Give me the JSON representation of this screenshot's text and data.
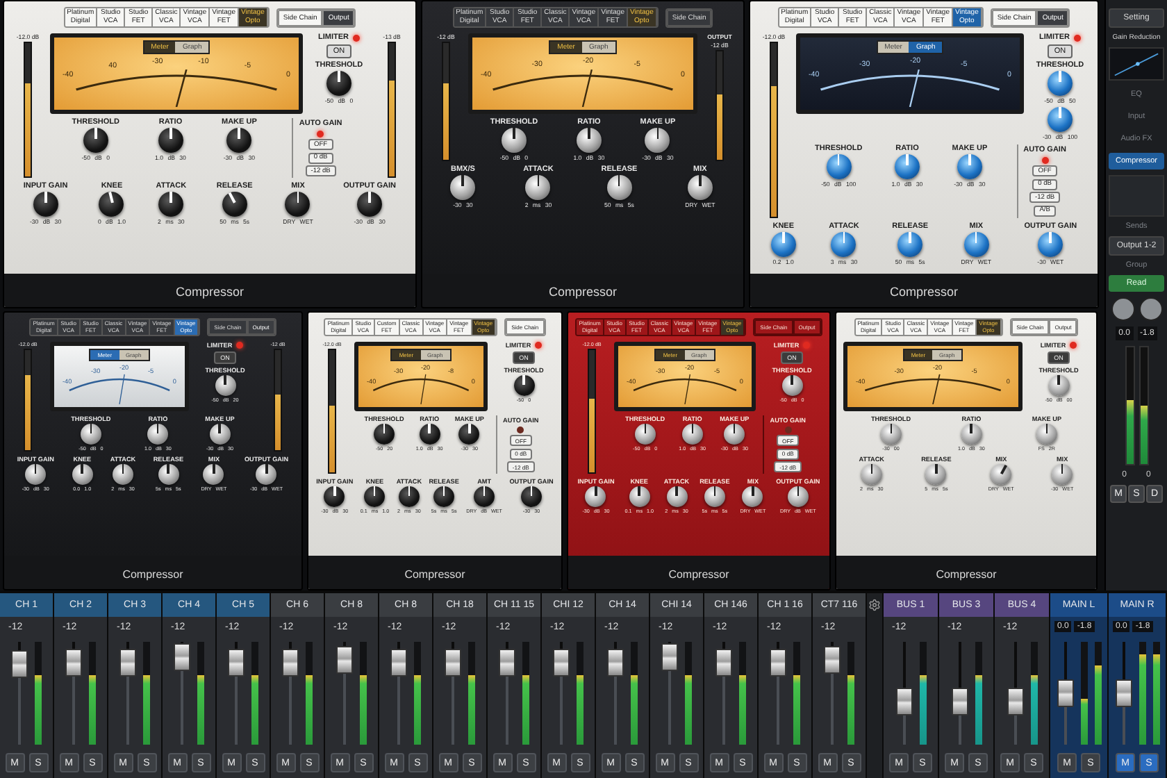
{
  "panels": [
    {
      "kind": "silver",
      "models": [
        {
          "label": "Platinum Digital",
          "selected": false
        },
        {
          "label": "Studio VCA",
          "selected": false
        },
        {
          "label": "Studio FET",
          "selected": false
        },
        {
          "label": "Classic VCA",
          "selected": false
        },
        {
          "label": "Vintage VCA",
          "selected": false
        },
        {
          "label": "Vintage FET",
          "selected": false
        },
        {
          "label": "Vintage Opto",
          "selected": true
        }
      ],
      "routing": [
        {
          "label": "Side Chain",
          "selected": false
        },
        {
          "label": "Output",
          "selected": true
        }
      ],
      "input_meter": {
        "reading": "-12.0 dB",
        "level": 0.7
      },
      "output_meter": {
        "reading": "-13 dB",
        "level": 0.72
      },
      "display": {
        "modes": [
          {
            "label": "Meter",
            "selected": true
          },
          {
            "label": "Graph",
            "selected": false
          }
        ],
        "scale": [
          "-40",
          "40",
          "-30",
          "-10",
          "-5",
          "0"
        ]
      },
      "limiter": {
        "label": "LIMITER",
        "led": true,
        "button": {
          "label": "ON",
          "on": true
        },
        "threshold": {
          "label": "THRESHOLD",
          "scale": "-50 dB 0",
          "level": 0.5
        }
      },
      "knob_rows": [
        [
          {
            "label": "THRESHOLD",
            "scale": "-50 dB 0",
            "level": 0.5
          },
          {
            "label": "RATIO",
            "scale": "1.0 dB 30",
            "level": 0.5
          },
          {
            "label": "MAKE UP",
            "scale": "-30 dB 30",
            "level": 0.5
          }
        ],
        [
          {
            "label": "INPUT GAIN",
            "scale": "-30 dB 30",
            "level": 0.5
          },
          {
            "label": "KNEE",
            "scale": "0 dB 1.0",
            "level": 0.45
          },
          {
            "label": "ATTACK",
            "scale": "2 ms 30",
            "level": 0.5
          },
          {
            "label": "RELEASE",
            "scale": "50 ms 5s",
            "level": 0.4
          },
          {
            "label": "MIX",
            "scale": "DRY WET",
            "level": 0.5
          },
          {
            "label": "OUTPUT GAIN",
            "scale": "-30 dB 30",
            "level": 0.5
          }
        ]
      ],
      "auto_gain": {
        "label": "AUTO GAIN",
        "led": true,
        "buttons": [
          "OFF",
          "0 dB",
          "-12 dB"
        ]
      },
      "footer": "Compressor"
    },
    {
      "kind": "black",
      "models": [
        {
          "label": "Platinum Digital",
          "selected": false
        },
        {
          "label": "Studio VCA",
          "selected": false
        },
        {
          "label": "Studio FET",
          "selected": false
        },
        {
          "label": "Classic VCA",
          "selected": false
        },
        {
          "label": "Vintage VCA",
          "selected": false
        },
        {
          "label": "Vintage FET",
          "selected": false
        },
        {
          "label": "Vintage Opto",
          "selected": true
        }
      ],
      "routing": [
        {
          "label": "Side Chain",
          "selected": false
        }
      ],
      "input_meter": {
        "reading": "-12 dB",
        "level": 0.65
      },
      "output_meter": {
        "title": "OUTPUT",
        "reading": "-12 dB",
        "level": 0.6
      },
      "display": {
        "modes": [
          {
            "label": "Meter",
            "selected": true
          },
          {
            "label": "Graph",
            "selected": false
          }
        ],
        "scale": [
          "-40",
          "-30",
          "-20",
          "-5",
          "0"
        ]
      },
      "knob_rows": [
        [
          {
            "label": "THRESHOLD",
            "scale": "-50 dB 0",
            "level": 0.5
          },
          {
            "label": "RATIO",
            "scale": "1.0 dB 30",
            "level": 0.5
          },
          {
            "label": "MAKE UP",
            "scale": "-30 dB 30",
            "level": 0.5
          }
        ],
        [
          {
            "label": "BMX/S",
            "scale": "-30 30",
            "level": 0.5
          },
          {
            "label": "ATTACK",
            "scale": "2 ms 30",
            "level": 0.5
          },
          {
            "label": "RELEASE",
            "scale": "50 ms 5s",
            "level": 0.5
          },
          {
            "label": "MIX",
            "scale": "DRY WET",
            "level": 0.5
          }
        ]
      ],
      "footer": "Compressor"
    },
    {
      "kind": "silver",
      "models": [
        {
          "label": "Platinum Digital",
          "selected": false
        },
        {
          "label": "Studio VCA",
          "selected": false
        },
        {
          "label": "Studio FET",
          "selected": false
        },
        {
          "label": "Classic VCA",
          "selected": false
        },
        {
          "label": "Vintage VCA",
          "selected": false
        },
        {
          "label": "Vintage FET",
          "selected": false
        },
        {
          "label": "Vintage Opto",
          "selected": true
        }
      ],
      "routing": [
        {
          "label": "Side Chain",
          "selected": false
        },
        {
          "label": "Output",
          "selected": true
        }
      ],
      "input_meter": {
        "reading": "-12.0 dB",
        "level": 0.75
      },
      "display": {
        "modes": [
          {
            "label": "Meter",
            "selected": false
          },
          {
            "label": "Graph",
            "selected": true
          }
        ],
        "scale": [
          "-40",
          "-30",
          "-20",
          "-5",
          "0"
        ]
      },
      "limiter": {
        "label": "LIMITER",
        "led": true,
        "button": {
          "label": "ON",
          "on": true
        },
        "threshold": {
          "label": "THRESHOLD",
          "scale": "-50 dB 50",
          "level": 0.5
        },
        "extra": {
          "scale": "-30 dB 100",
          "level": 0.5
        }
      },
      "knob_rows": [
        [
          {
            "label": "THRESHOLD",
            "scale": "-50 dB 100",
            "level": 0.5
          },
          {
            "label": "RATIO",
            "scale": "1.0 dB 30",
            "level": 0.5
          },
          {
            "label": "MAKE UP",
            "scale": "-30 dB 30",
            "level": 0.5
          }
        ],
        [
          {
            "label": "KNEE",
            "scale": "0.2 1.0",
            "level": 0.5
          },
          {
            "label": "ATTACK",
            "scale": "3 ms 30",
            "level": 0.5
          },
          {
            "label": "RELEASE",
            "scale": "50 ms 5s",
            "level": 0.5
          },
          {
            "label": "MIX",
            "scale": "DRY WET",
            "level": 0.5
          },
          {
            "label": "OUTPUT GAIN",
            "scale": "-30 WET",
            "level": 0.5
          }
        ]
      ],
      "auto_gain": {
        "label": "AUTO GAIN",
        "led": true,
        "buttons": [
          "OFF",
          "0 dB",
          "-12 dB",
          "A/B"
        ]
      },
      "footer": "Compressor"
    },
    {
      "kind": "black",
      "models": [
        {
          "label": "Platinum Digital",
          "selected": false
        },
        {
          "label": "Studio VCA",
          "selected": false
        },
        {
          "label": "Studio FET",
          "selected": false
        },
        {
          "label": "Classic VCA",
          "selected": false
        },
        {
          "label": "Vintage VCA",
          "selected": false
        },
        {
          "label": "Vintage FET",
          "selected": false
        },
        {
          "label": "Vintage Opto",
          "selected": true
        }
      ],
      "routing": [
        {
          "label": "Side Chain",
          "selected": false
        },
        {
          "label": "Output",
          "selected": true
        }
      ],
      "input_meter": {
        "reading": "-12.0 dB",
        "level": 0.75
      },
      "output_meter": {
        "reading": "-12 dB",
        "level": 0.55
      },
      "display": {
        "modes": [
          {
            "label": "Meter",
            "selected": true
          },
          {
            "label": "Graph",
            "selected": false
          }
        ],
        "scale": [
          "-40",
          "-30",
          "-20",
          "-5",
          "0"
        ]
      },
      "limiter": {
        "label": "LIMITER",
        "led": true,
        "button": {
          "label": "ON",
          "on": false
        },
        "threshold": {
          "label": "THRESHOLD",
          "scale": "-50 dB 20",
          "level": 0.5
        }
      },
      "knob_rows": [
        [
          {
            "label": "THRESHOLD",
            "scale": "-50 dB 0",
            "level": 0.5
          },
          {
            "label": "RATIO",
            "scale": "1.0 dB 30",
            "level": 0.5
          },
          {
            "label": "MAKE UP",
            "scale": "-30 dB 30",
            "level": 0.5
          }
        ],
        [
          {
            "label": "INPUT GAIN",
            "scale": "-30 dB 30",
            "level": 0.5
          },
          {
            "label": "KNEE",
            "scale": "0.0 1.0",
            "level": 0.5
          },
          {
            "label": "ATTACK",
            "scale": "2 ms 30",
            "level": 0.5
          },
          {
            "label": "RELEASE",
            "scale": "5s ms 5s",
            "level": 0.5
          },
          {
            "label": "MIX",
            "scale": "DRY WET",
            "level": 0.5
          },
          {
            "label": "OUTPUT GAIN",
            "scale": "-30 dB WET",
            "level": 0.5
          }
        ]
      ],
      "footer": "Compressor"
    },
    {
      "kind": "silver",
      "models": [
        {
          "label": "Platinum Digital",
          "selected": false
        },
        {
          "label": "Studio VCA",
          "selected": false
        },
        {
          "label": "Custom FET",
          "selected": false
        },
        {
          "label": "Classic VCA",
          "selected": false
        },
        {
          "label": "Vintage VCA",
          "selected": false
        },
        {
          "label": "Vintage FET",
          "selected": false
        },
        {
          "label": "Vintage Opto",
          "selected": true
        }
      ],
      "routing": [
        {
          "label": "Side Chain",
          "selected": false
        }
      ],
      "input_meter": {
        "reading": "-12.0 dB",
        "level": 0.55
      },
      "display": {
        "modes": [
          {
            "label": "Meter",
            "selected": true
          },
          {
            "label": "Graph",
            "selected": false
          }
        ],
        "scale": [
          "-40",
          "-30",
          "-20",
          "-8",
          "0"
        ]
      },
      "limiter": {
        "label": "LIMITER",
        "led": true,
        "button": {
          "label": "ON",
          "on": false
        },
        "threshold": {
          "label": "THRESHOLD",
          "scale": "-50 0",
          "level": 0.5
        }
      },
      "knob_rows": [
        [
          {
            "label": "THRESHOLD",
            "scale": "-50 20",
            "level": 0.5
          },
          {
            "label": "RATIO",
            "scale": "1.0 dB 30",
            "level": 0.5
          },
          {
            "label": "MAKE UP",
            "scale": "-30 30",
            "level": 0.5
          }
        ],
        [
          {
            "label": "INPUT GAIN",
            "scale": "-30 dB 30",
            "level": 0.5
          },
          {
            "label": "KNEE",
            "scale": "0.1 ms 1.0",
            "level": 0.5
          },
          {
            "label": "ATTACK",
            "scale": "2 ms 30",
            "level": 0.5
          },
          {
            "label": "RELEASE",
            "scale": "5s ms 5s",
            "level": 0.5
          },
          {
            "label": "AMT",
            "scale": "DRY dB WET",
            "level": 0.5
          },
          {
            "label": "OUTPUT GAIN",
            "scale": "-30 30",
            "level": 0.5
          }
        ]
      ],
      "auto_gain": {
        "label": "AUTO GAIN",
        "led": false,
        "buttons": [
          "OFF",
          "0 dB",
          "-12 dB"
        ]
      },
      "footer": "Compressor"
    },
    {
      "kind": "red",
      "models": [
        {
          "label": "Platinum Digital",
          "selected": false
        },
        {
          "label": "Studio VCA",
          "selected": false
        },
        {
          "label": "Studio FET",
          "selected": false
        },
        {
          "label": "Classic VCA",
          "selected": false
        },
        {
          "label": "Vintage VCA",
          "selected": false
        },
        {
          "label": "Vintage FET",
          "selected": false
        },
        {
          "label": "Vintage Opto",
          "selected": true
        }
      ],
      "routing": [
        {
          "label": "Side Chain",
          "selected": false
        },
        {
          "label": "Output",
          "selected": false
        }
      ],
      "input_meter": {
        "reading": "-12.0 dB",
        "level": 0.6
      },
      "display": {
        "modes": [
          {
            "label": "Meter",
            "selected": true
          },
          {
            "label": "Graph",
            "selected": false
          }
        ],
        "scale": [
          "-40",
          "-30",
          "-20",
          "-5",
          "0"
        ]
      },
      "limiter": {
        "label": "LIMITER",
        "led": true,
        "button": {
          "label": "ON",
          "on": false
        },
        "threshold": {
          "label": "THRESHOLD",
          "scale": "-50 dB 0",
          "level": 0.5
        }
      },
      "knob_rows": [
        [
          {
            "label": "THRESHOLD",
            "scale": "-50 dB 0",
            "level": 0.5
          },
          {
            "label": "RATIO",
            "scale": "1.0 dB 30",
            "level": 0.5
          },
          {
            "label": "MAKE UP",
            "scale": "-30 dB 30",
            "level": 0.5
          }
        ],
        [
          {
            "label": "INPUT GAIN",
            "scale": "-30 dB 30",
            "level": 0.5
          },
          {
            "label": "KNEE",
            "scale": "0.1 ms 1.0",
            "level": 0.5
          },
          {
            "label": "ATTACK",
            "scale": "2 ms 30",
            "level": 0.5
          },
          {
            "label": "RELEASE",
            "scale": "5s ms 5s",
            "level": 0.5
          },
          {
            "label": "MIX",
            "scale": "DRY WET",
            "level": 0.5
          },
          {
            "label": "OUTPUT GAIN",
            "scale": "DRY dB WET",
            "level": 0.5
          }
        ]
      ],
      "auto_gain": {
        "label": "AUTO GAIN",
        "led": false,
        "buttons": [
          "OFF",
          "0 dB",
          "-12 dB"
        ]
      },
      "footer": "Compressor"
    },
    {
      "kind": "silver",
      "models": [
        {
          "label": "Platinum Digital",
          "selected": false
        },
        {
          "label": "Studio VCA",
          "selected": false
        },
        {
          "label": "Classic VCA",
          "selected": false
        },
        {
          "label": "Vintage VCA",
          "selected": false
        },
        {
          "label": "Vintage FET",
          "selected": false
        },
        {
          "label": "Vintage Opto",
          "selected": true
        }
      ],
      "routing": [
        {
          "label": "Side Chain",
          "selected": false
        },
        {
          "label": "Output",
          "selected": false
        }
      ],
      "display": {
        "modes": [
          {
            "label": "Meter",
            "selected": true
          },
          {
            "label": "Graph",
            "selected": false
          }
        ],
        "scale": [
          "-40",
          "-30",
          "-20",
          "-5",
          "0"
        ]
      },
      "limiter": {
        "label": "LIMITER",
        "led": true,
        "button": {
          "label": "ON",
          "on": false
        },
        "threshold": {
          "label": "THRESHOLD",
          "scale": "-50 dB 00",
          "level": 0.5
        }
      },
      "knob_rows": [
        [
          {
            "label": "THRESHOLD",
            "scale": "-30 00",
            "level": 0.5
          },
          {
            "label": "RATIO",
            "scale": "1.0 dB 30",
            "level": 0.5
          },
          {
            "label": "MAKE UP",
            "scale": "FS 2R",
            "level": 0.5
          }
        ],
        [
          {
            "label": "ATTACK",
            "scale": "2 ms 30",
            "level": 0.5
          },
          {
            "label": "RELEASE",
            "scale": "5 ms 5s",
            "level": 0.5
          },
          {
            "label": "MIX",
            "scale": "DRY WET",
            "level": 0.6
          },
          {
            "label": "MIX",
            "scale": "-30 WET",
            "level": 0.5
          }
        ]
      ],
      "footer": "Compressor"
    }
  ],
  "sidebar": {
    "setting": "Setting",
    "gain_reduction": "Gain Reduction",
    "sections": [
      {
        "label": "EQ",
        "selected": false
      },
      {
        "label": "Input",
        "selected": false
      },
      {
        "label": "Audio FX",
        "selected": false
      },
      {
        "label": "Compressor",
        "selected": true
      }
    ],
    "sends": "Sends",
    "output": "Output 1-2",
    "group": "Group",
    "automation": "Read",
    "pan_readings": [
      "0.0",
      "-1.8"
    ],
    "meters": [
      {
        "level": 0.55
      },
      {
        "level": 0.5
      }
    ],
    "meter_labels": [
      "0",
      "0"
    ],
    "buttons": [
      {
        "label": "M",
        "on": false
      },
      {
        "label": "S",
        "on": false
      },
      {
        "label": "D",
        "on": false
      }
    ]
  },
  "mixer": {
    "strips": [
      {
        "kind": "channel",
        "name": "CH 1",
        "selected": true,
        "readings": [
          "-12"
        ],
        "level": 0.78,
        "meters": [
          {
            "level": 0.68
          }
        ],
        "buttons": [
          {
            "label": "M",
            "on": false
          },
          {
            "label": "S",
            "on": false
          }
        ]
      },
      {
        "kind": "channel",
        "name": "CH 2",
        "selected": true,
        "readings": [
          "-12"
        ],
        "level": 0.8,
        "meters": [
          {
            "level": 0.68
          }
        ],
        "buttons": [
          {
            "label": "M",
            "on": false
          },
          {
            "label": "S",
            "on": false
          }
        ]
      },
      {
        "kind": "channel",
        "name": "CH 3",
        "selected": true,
        "readings": [
          "-12"
        ],
        "level": 0.8,
        "meters": [
          {
            "level": 0.68
          }
        ],
        "buttons": [
          {
            "label": "M",
            "on": false
          },
          {
            "label": "S",
            "on": false
          }
        ]
      },
      {
        "kind": "channel",
        "name": "CH 4",
        "selected": true,
        "readings": [
          "-12"
        ],
        "level": 0.85,
        "meters": [
          {
            "level": 0.68
          }
        ],
        "buttons": [
          {
            "label": "M",
            "on": false
          },
          {
            "label": "S",
            "on": false
          }
        ]
      },
      {
        "kind": "channel",
        "name": "CH 5",
        "selected": true,
        "readings": [
          "-12"
        ],
        "level": 0.8,
        "meters": [
          {
            "level": 0.68
          }
        ],
        "buttons": [
          {
            "label": "M",
            "on": false
          },
          {
            "label": "S",
            "on": false
          }
        ]
      },
      {
        "kind": "channel",
        "name": "CH 6",
        "selected": false,
        "readings": [
          "-12"
        ],
        "level": 0.8,
        "meters": [
          {
            "level": 0.68
          }
        ],
        "buttons": [
          {
            "label": "M",
            "on": false
          },
          {
            "label": "S",
            "on": false
          }
        ]
      },
      {
        "kind": "channel",
        "name": "CH 8",
        "selected": false,
        "readings": [
          "-12"
        ],
        "level": 0.82,
        "meters": [
          {
            "level": 0.68
          }
        ],
        "buttons": [
          {
            "label": "M",
            "on": false
          },
          {
            "label": "S",
            "on": false
          }
        ]
      },
      {
        "kind": "channel",
        "name": "CH 8",
        "selected": false,
        "readings": [
          "-12"
        ],
        "level": 0.8,
        "meters": [
          {
            "level": 0.68
          }
        ],
        "buttons": [
          {
            "label": "M",
            "on": false
          },
          {
            "label": "S",
            "on": false
          }
        ]
      },
      {
        "kind": "channel",
        "name": "CH 18",
        "selected": false,
        "readings": [
          "-12"
        ],
        "level": 0.8,
        "meters": [
          {
            "level": 0.68
          }
        ],
        "buttons": [
          {
            "label": "M",
            "on": false
          },
          {
            "label": "S",
            "on": false
          }
        ]
      },
      {
        "kind": "channel",
        "name": "CH 11 15",
        "selected": false,
        "readings": [
          "-12"
        ],
        "level": 0.8,
        "meters": [
          {
            "level": 0.68
          }
        ],
        "buttons": [
          {
            "label": "M",
            "on": false
          },
          {
            "label": "S",
            "on": false
          }
        ]
      },
      {
        "kind": "channel",
        "name": "CHI 12",
        "selected": false,
        "readings": [
          "-12"
        ],
        "level": 0.8,
        "meters": [
          {
            "level": 0.68
          }
        ],
        "buttons": [
          {
            "label": "M",
            "on": false
          },
          {
            "label": "S",
            "on": false
          }
        ]
      },
      {
        "kind": "channel",
        "name": "CH 14",
        "selected": false,
        "readings": [
          "-12"
        ],
        "level": 0.8,
        "meters": [
          {
            "level": 0.68
          }
        ],
        "buttons": [
          {
            "label": "M",
            "on": false
          },
          {
            "label": "S",
            "on": false
          }
        ]
      },
      {
        "kind": "channel",
        "name": "CHI 14",
        "selected": false,
        "readings": [
          "-12"
        ],
        "level": 0.85,
        "meters": [
          {
            "level": 0.68
          }
        ],
        "buttons": [
          {
            "label": "M",
            "on": false
          },
          {
            "label": "S",
            "on": false
          }
        ]
      },
      {
        "kind": "channel",
        "name": "CH 146",
        "selected": false,
        "readings": [
          "-12"
        ],
        "level": 0.8,
        "meters": [
          {
            "level": 0.68
          }
        ],
        "buttons": [
          {
            "label": "M",
            "on": false
          },
          {
            "label": "S",
            "on": false
          }
        ]
      },
      {
        "kind": "channel",
        "name": "CH 1 16",
        "selected": false,
        "readings": [
          "-12"
        ],
        "level": 0.8,
        "meters": [
          {
            "level": 0.68
          }
        ],
        "buttons": [
          {
            "label": "M",
            "on": false
          },
          {
            "label": "S",
            "on": false
          }
        ]
      },
      {
        "kind": "channel",
        "name": "CT7 116",
        "selected": false,
        "readings": [
          "-12"
        ],
        "level": 0.82,
        "meters": [
          {
            "level": 0.68
          }
        ],
        "buttons": [
          {
            "label": "M",
            "on": false
          },
          {
            "label": "S",
            "on": false
          }
        ]
      },
      {
        "kind": "spacer"
      },
      {
        "kind": "bus",
        "name": "BUS 1",
        "selected": false,
        "readings": [
          "-12"
        ],
        "level": 0.42,
        "meters": [
          {
            "level": 0.68
          }
        ],
        "buttons": [
          {
            "label": "M",
            "on": false
          },
          {
            "label": "S",
            "on": false
          }
        ]
      },
      {
        "kind": "bus",
        "name": "BUS 3",
        "selected": false,
        "readings": [
          "-12"
        ],
        "level": 0.42,
        "meters": [
          {
            "level": 0.68
          }
        ],
        "buttons": [
          {
            "label": "M",
            "on": false
          },
          {
            "label": "S",
            "on": false
          }
        ]
      },
      {
        "kind": "bus",
        "name": "BUS 4",
        "selected": false,
        "readings": [
          "-12"
        ],
        "level": 0.42,
        "meters": [
          {
            "level": 0.68
          }
        ],
        "buttons": [
          {
            "label": "M",
            "on": false
          },
          {
            "label": "S",
            "on": false
          }
        ]
      },
      {
        "kind": "main",
        "name": "MAIN L",
        "selected": false,
        "readings": [
          "0.0",
          "-1.8"
        ],
        "level": 0.5,
        "meters": [
          {
            "level": 0.45
          },
          {
            "level": 0.77
          }
        ],
        "buttons": [
          {
            "label": "M",
            "on": false
          },
          {
            "label": "S",
            "on": false
          }
        ]
      },
      {
        "kind": "main",
        "name": "MAIN R",
        "selected": false,
        "readings": [
          "0.0",
          "-1.8"
        ],
        "level": 0.5,
        "meters": [
          {
            "level": 0.88
          },
          {
            "level": 0.88
          }
        ],
        "buttons": [
          {
            "label": "M",
            "on": true
          },
          {
            "label": "S",
            "on": true
          }
        ]
      }
    ]
  }
}
